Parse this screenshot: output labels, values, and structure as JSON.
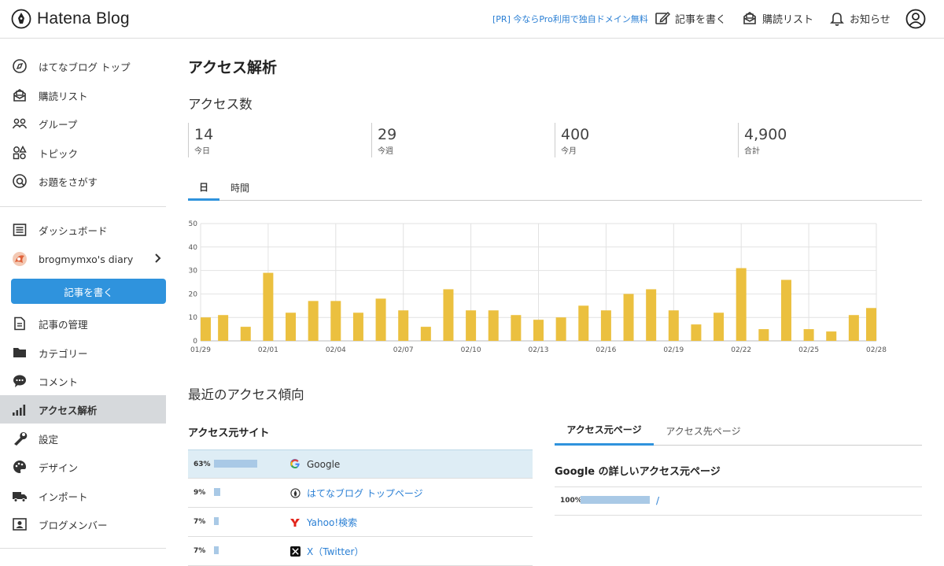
{
  "header": {
    "logo_text": "Hatena Blog",
    "pr_link": "[PR] 今ならPro利用で独自ドメイン無料",
    "write_label": "記事を書く",
    "reading_list_label": "購読リスト",
    "notifications_label": "お知らせ"
  },
  "sidebar": {
    "top_items": [
      {
        "label": "はてなブログ トップ",
        "icon": "compass-icon"
      },
      {
        "label": "購読リスト",
        "icon": "reading-list-icon"
      },
      {
        "label": "グループ",
        "icon": "group-icon"
      },
      {
        "label": "トピック",
        "icon": "topic-icon"
      },
      {
        "label": "お題をさがす",
        "icon": "theme-icon"
      }
    ],
    "dashboard_label": "ダッシュボード",
    "blog_name": "brogmymxo's diary",
    "write_button": "記事を書く",
    "blog_items": [
      {
        "label": "記事の管理",
        "icon": "document-icon"
      },
      {
        "label": "カテゴリー",
        "icon": "folder-icon"
      },
      {
        "label": "コメント",
        "icon": "comment-icon"
      },
      {
        "label": "アクセス解析",
        "icon": "signal-icon"
      },
      {
        "label": "設定",
        "icon": "wrench-icon"
      },
      {
        "label": "デザイン",
        "icon": "palette-icon"
      },
      {
        "label": "インポート",
        "icon": "truck-icon"
      },
      {
        "label": "ブログメンバー",
        "icon": "member-icon"
      }
    ],
    "active_item": "アクセス解析"
  },
  "main": {
    "title": "アクセス解析",
    "access_count_title": "アクセス数",
    "stats": [
      {
        "value": "14",
        "label": "今日"
      },
      {
        "value": "29",
        "label": "今週"
      },
      {
        "value": "400",
        "label": "今月"
      },
      {
        "value": "4,900",
        "label": "合計"
      }
    ],
    "tabs": [
      {
        "label": "日",
        "active": true
      },
      {
        "label": "時間",
        "active": false
      }
    ],
    "trend_title": "最近のアクセス傾向",
    "referrer_title": "アクセス元サイト",
    "referrers": [
      {
        "pct": "63%",
        "value": 63,
        "site": "Google",
        "icon": "google-icon",
        "link": false
      },
      {
        "pct": "9%",
        "value": 9,
        "site": "はてなブログ トップページ",
        "icon": "hatena-icon",
        "link": true
      },
      {
        "pct": "7%",
        "value": 7,
        "site": "Yahoo!検索",
        "icon": "yahoo-icon",
        "link": true
      },
      {
        "pct": "7%",
        "value": 7,
        "site": "X（Twitter）",
        "icon": "x-icon",
        "link": true
      }
    ],
    "right_tabs": [
      {
        "label": "アクセス元ページ",
        "active": true
      },
      {
        "label": "アクセス先ページ",
        "active": false
      }
    ],
    "detail_title": "Google の詳しいアクセス元ページ",
    "detail_rows": [
      {
        "pct": "100%",
        "value": 100,
        "path": "/"
      }
    ]
  },
  "chart_data": {
    "type": "bar",
    "categories": [
      "01/29",
      "01/30",
      "01/31",
      "02/01",
      "02/02",
      "02/03",
      "02/04",
      "02/05",
      "02/06",
      "02/07",
      "02/08",
      "02/09",
      "02/10",
      "02/11",
      "02/12",
      "02/13",
      "02/14",
      "02/15",
      "02/16",
      "02/17",
      "02/18",
      "02/19",
      "02/20",
      "02/21",
      "02/22",
      "02/23",
      "02/24",
      "02/25",
      "02/26",
      "02/27",
      "02/28"
    ],
    "tick_labels": [
      "01/29",
      "02/01",
      "02/04",
      "02/07",
      "02/10",
      "02/13",
      "02/16",
      "02/19",
      "02/22",
      "02/25",
      "02/28"
    ],
    "values": [
      10,
      11,
      6,
      29,
      12,
      17,
      17,
      12,
      18,
      13,
      6,
      22,
      13,
      13,
      11,
      9,
      10,
      15,
      13,
      20,
      22,
      13,
      7,
      12,
      31,
      5,
      26,
      5,
      4,
      11,
      14
    ],
    "ylim": [
      0,
      50
    ],
    "yticks": [
      0,
      10,
      20,
      30,
      40,
      50
    ],
    "bar_color": "#ebc03f",
    "grid": true
  },
  "colors": {
    "accent": "#2f93dd",
    "link": "#2a7fd4",
    "bar": "#ebc03f",
    "highlight_row": "#deedf5",
    "ref_bar": "#a9c9e6"
  }
}
